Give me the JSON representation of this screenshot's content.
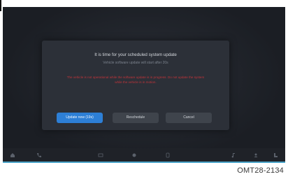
{
  "dialog": {
    "title": "It is time for your scheduled system update",
    "subtitle": "Vehicle software update will start after 20s",
    "warning": "The vehicle is not operational while the software update is in progress. Do not update the system while the vehicle is in motion.",
    "buttons": {
      "update_now": "Update now (19s)",
      "reschedule": "Reschedule",
      "cancel": "Cancel"
    }
  },
  "background": {
    "left_text": "",
    "right_text": ""
  },
  "navbar": {
    "icons": [
      "home-icon",
      "phone-icon",
      "media-icon",
      "navigation-icon",
      "climate-icon",
      "music-icon",
      "voice-icon",
      "seat-icon"
    ]
  },
  "caption": "OMT28-2134",
  "colors": {
    "primary_button": "#2d7fd6",
    "warning_text": "#c4343a",
    "accent_line": "#4aa3c8"
  }
}
